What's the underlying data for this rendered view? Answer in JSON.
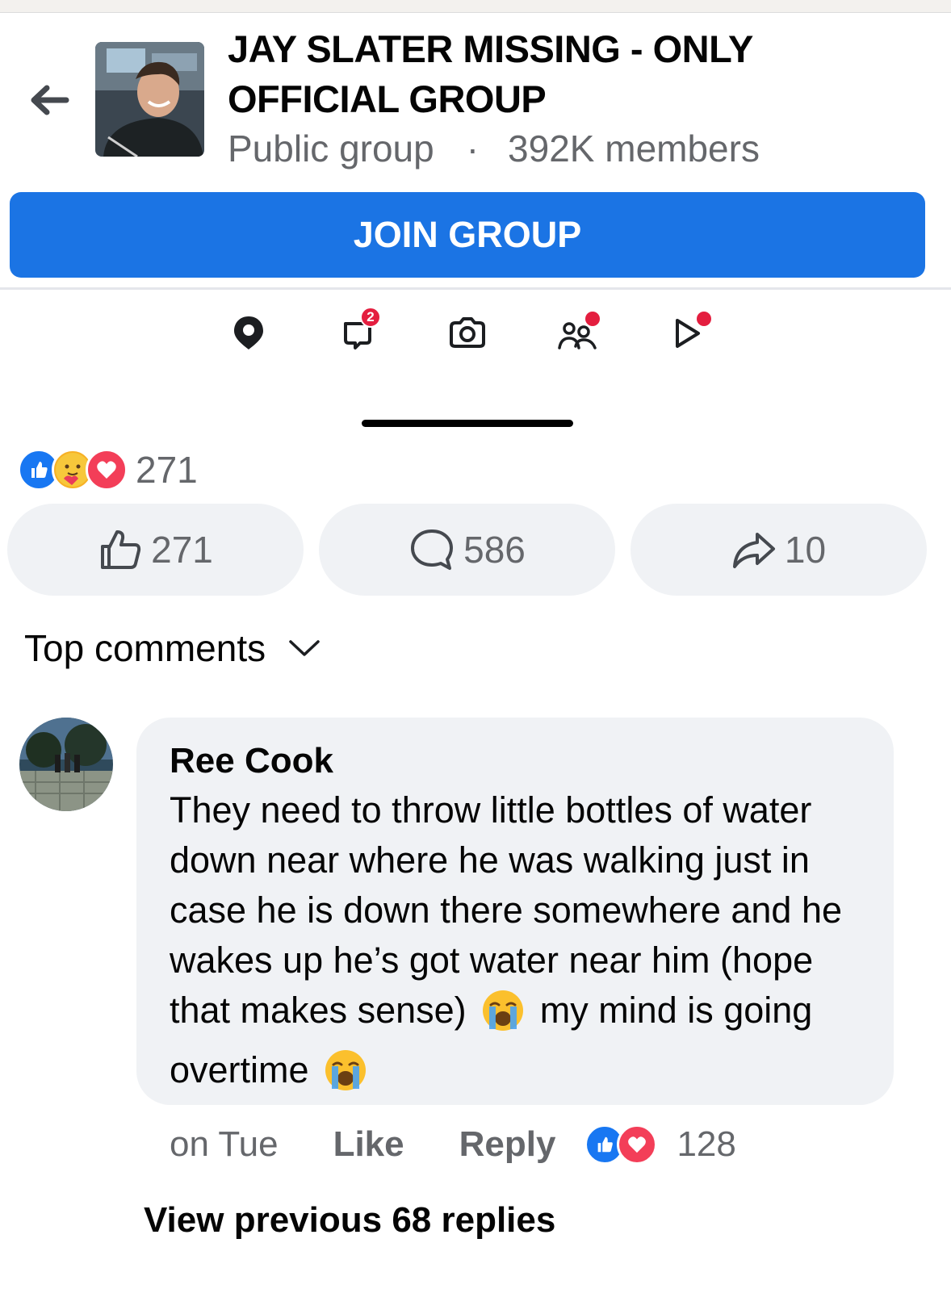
{
  "group": {
    "title": "JAY SLATER MISSING - ONLY OFFICIAL GROUP",
    "privacy": "Public group",
    "separator": "·",
    "members": "392K members",
    "join_label": "JOIN GROUP"
  },
  "tabs": [
    {
      "icon": "location-pin-icon"
    },
    {
      "icon": "chat-bubble-icon",
      "badge": "2"
    },
    {
      "icon": "camera-icon"
    },
    {
      "icon": "people-icon",
      "dot": true
    },
    {
      "icon": "play-icon",
      "dot": true
    }
  ],
  "post": {
    "reaction_icons": [
      "like-reaction-icon",
      "care-reaction-icon",
      "love-reaction-icon"
    ],
    "reaction_total": "271",
    "like_count": "271",
    "comment_count": "586",
    "share_count": "10"
  },
  "comments_section": {
    "sort_label": "Top comments"
  },
  "comment": {
    "author": "Ree Cook",
    "text_part1": "They need to throw little bottles of water down near where he was walking just in case he is down there somewhere and he wakes up he’s got water near him (hope that makes sense)",
    "text_part2": "my mind is going overtime",
    "emoji_icon": "loudly-crying-face-emoji",
    "time": "on Tue",
    "like_label": "Like",
    "reply_label": "Reply",
    "reaction_count": "128",
    "view_previous": "View previous 68 replies"
  },
  "colors": {
    "brand_blue": "#1b74e4",
    "secondary_text": "#65676b",
    "bubble_bg": "#f0f2f5",
    "notification_red": "#e41e3f"
  }
}
